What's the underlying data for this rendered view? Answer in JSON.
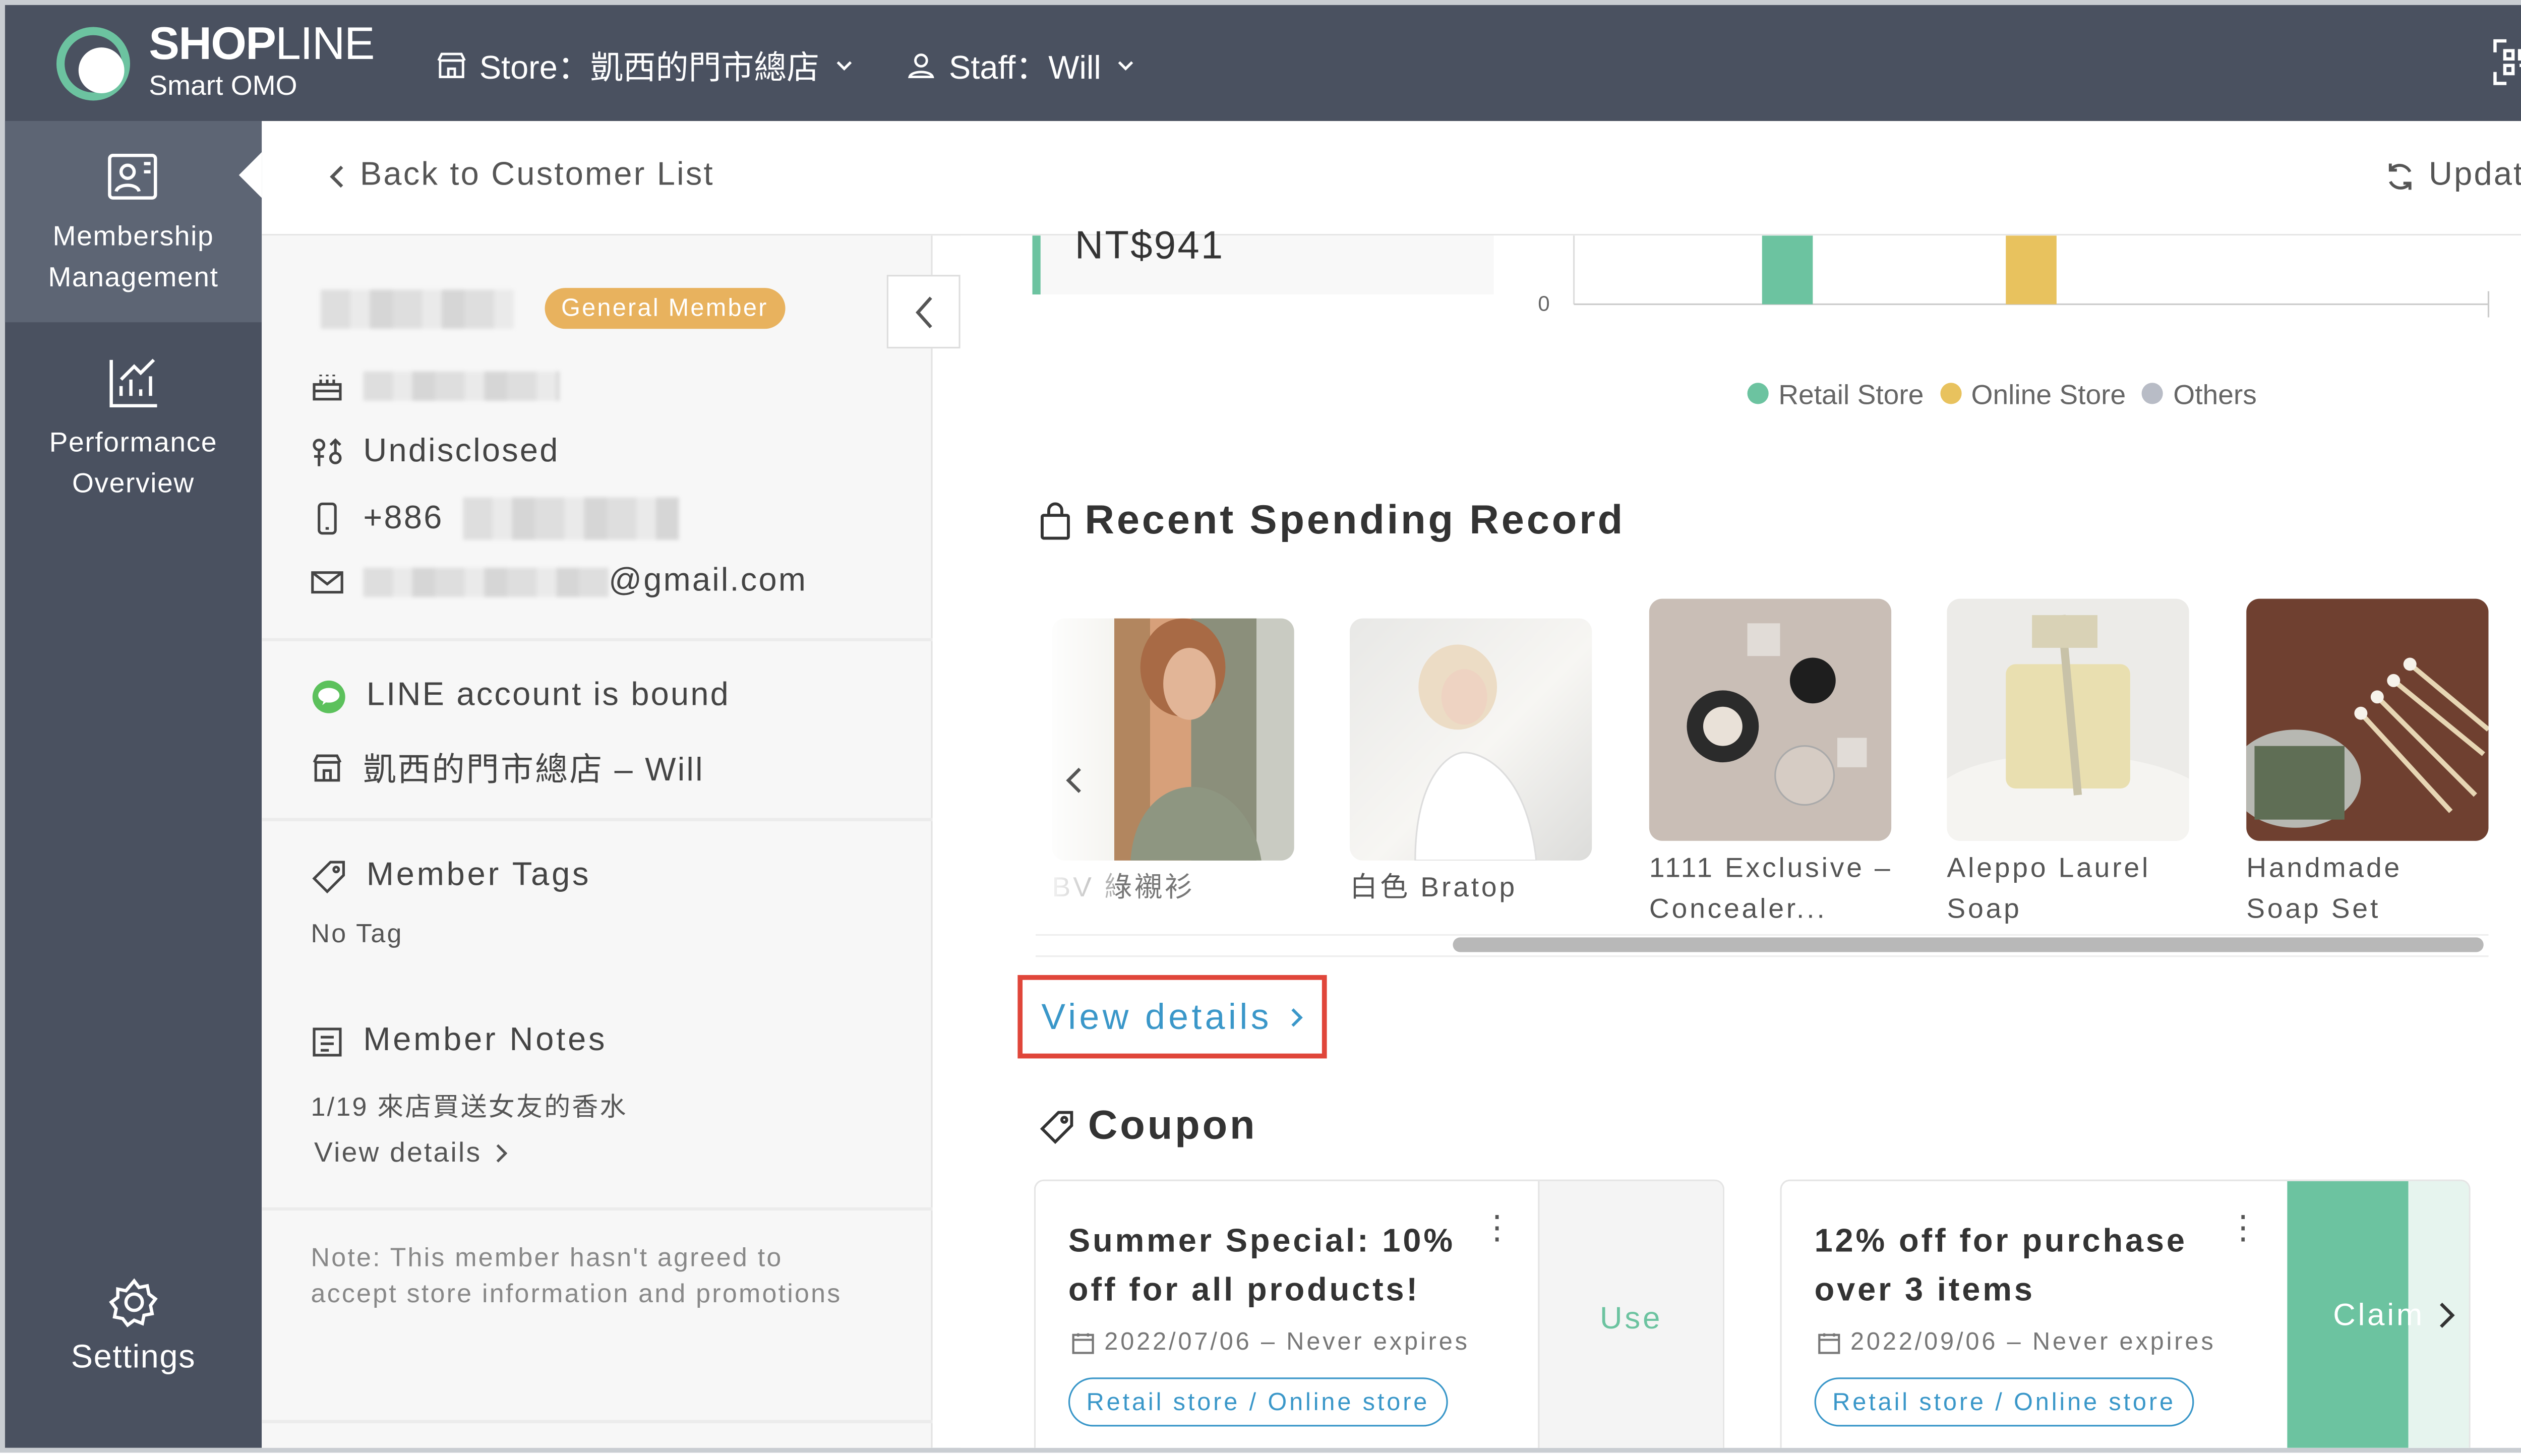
{
  "header": {
    "brand_name_bold": "SHOP",
    "brand_name_thin": "LINE",
    "brand_sub": "Smart OMO",
    "store_label": "Store：凱西的門市總店",
    "staff_label": "Staff：Will"
  },
  "sidebar": {
    "items": [
      {
        "line1": "Membership",
        "line2": "Management",
        "icon": "member-card-icon"
      },
      {
        "line1": "Performance",
        "line2": "Overview",
        "icon": "chart-icon"
      },
      {
        "line1": "Settings",
        "icon": "gear-icon"
      }
    ]
  },
  "nav": {
    "back_label": "Back to Customer List",
    "update_label": "Update"
  },
  "profile": {
    "member_badge": "General Member",
    "gender": "Undisclosed",
    "phone_prefix": "+886",
    "email_suffix": "@gmail.com",
    "line_status": "LINE account is bound",
    "store_staff": "凱西的門市總店 – Will",
    "tags_title": "Member Tags",
    "tags_value": "No Tag",
    "notes_title": "Member Notes",
    "notes_value": "1/19 來店買送女友的香水",
    "notes_link": "View details",
    "consent_note": "Note: This member hasn't agreed to accept store information and promotions"
  },
  "spending_summary": {
    "amount": "NT$941",
    "axis_zero": "0",
    "legend": [
      {
        "label": "Retail Store",
        "color": "#6cc3a0"
      },
      {
        "label": "Online Store",
        "color": "#e8c25e"
      },
      {
        "label": "Others",
        "color": "#b8bcc6"
      }
    ]
  },
  "recent_spending": {
    "title": "Recent Spending Record",
    "products": [
      {
        "name": "BV 綠襯衫"
      },
      {
        "name": "白色 Bratop"
      },
      {
        "line1": "1111 Exclusive –",
        "line2": "Concealer..."
      },
      {
        "line1": "Aleppo Laurel",
        "line2": "Soap"
      },
      {
        "line1": "Handmade",
        "line2": "Soap Set"
      }
    ],
    "view_details": "View details"
  },
  "coupons": {
    "title": "Coupon",
    "items": [
      {
        "line1": "Summer Special: 10%",
        "line2": "off for all products!",
        "date": "2022/07/06 – Never expires",
        "channels": "Retail store / Online store",
        "action": "Use"
      },
      {
        "line1": "12% off for purchase",
        "line2": "over 3 items",
        "date": "2022/09/06 – Never expires",
        "channels": "Retail store / Online store",
        "action": "Claim"
      }
    ]
  }
}
